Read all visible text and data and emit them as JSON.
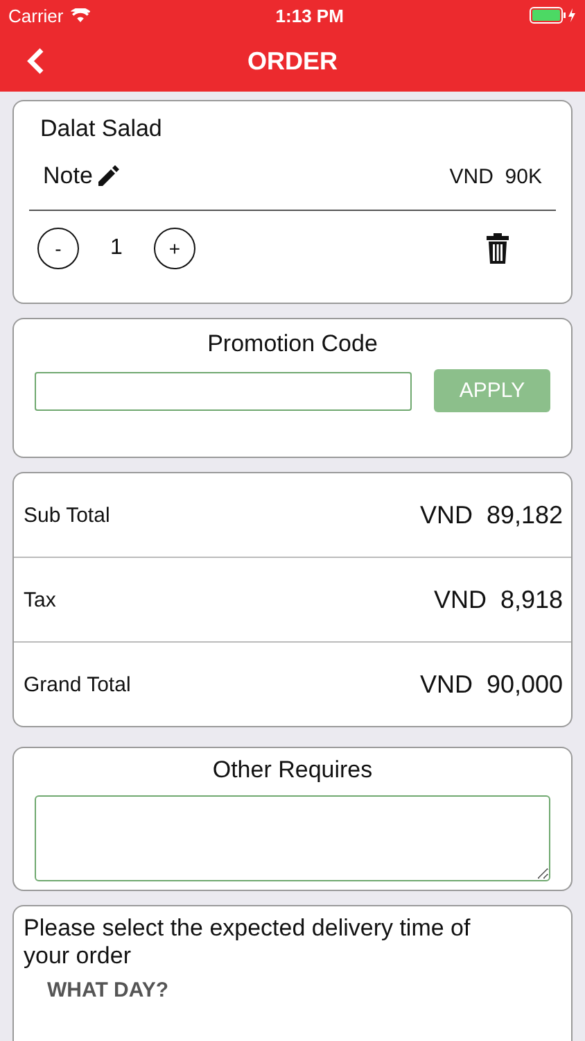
{
  "status_bar": {
    "carrier": "Carrier",
    "time": "1:13 PM"
  },
  "nav": {
    "title": "ORDER"
  },
  "items": [
    {
      "name": "Dalat Salad",
      "note": "Note",
      "price": "VND  90K",
      "quantity": "1",
      "minus": "-",
      "plus": "+"
    }
  ],
  "promotion": {
    "title": "Promotion Code",
    "button": "APPLY"
  },
  "totals": [
    {
      "label": "Sub Total",
      "value": "VND  89,182"
    },
    {
      "label": "Tax",
      "value": "VND  8,918"
    },
    {
      "label": "Grand Total",
      "value": "VND  90,000"
    }
  ],
  "other_requires": {
    "title": "Other Requires"
  },
  "delivery": {
    "prompt": "Please select the expected delivery time of your order",
    "day_heading": "WHAT DAY?"
  }
}
